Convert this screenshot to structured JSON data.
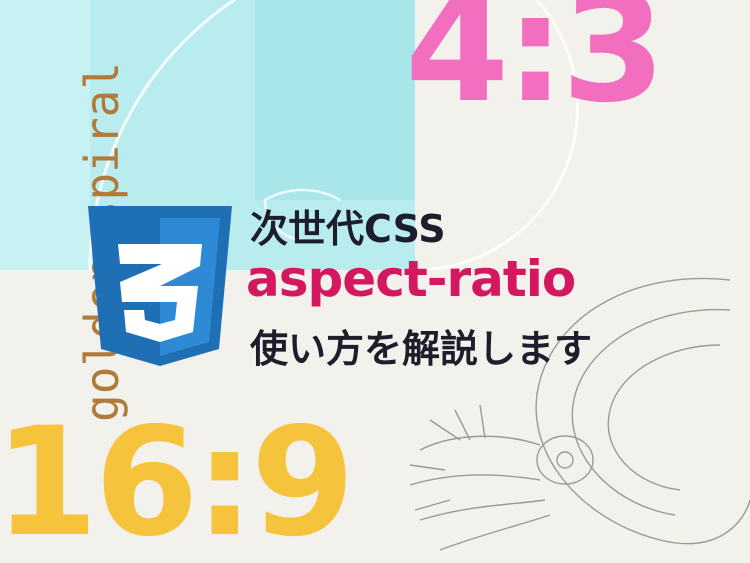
{
  "ratio_top": "4:3",
  "ratio_bottom": "16:9",
  "spiral_caption": "golden spiral",
  "logo_icon": "css3-logo-icon",
  "headline": {
    "line1": "次世代CSS",
    "line2": "aspect-ratio",
    "line3": "使い方を解説します"
  },
  "colors": {
    "pink": "#f26fc0",
    "yellow": "#f6c43c",
    "accent": "#d4185f",
    "css_blue": "#1f6fb5"
  }
}
